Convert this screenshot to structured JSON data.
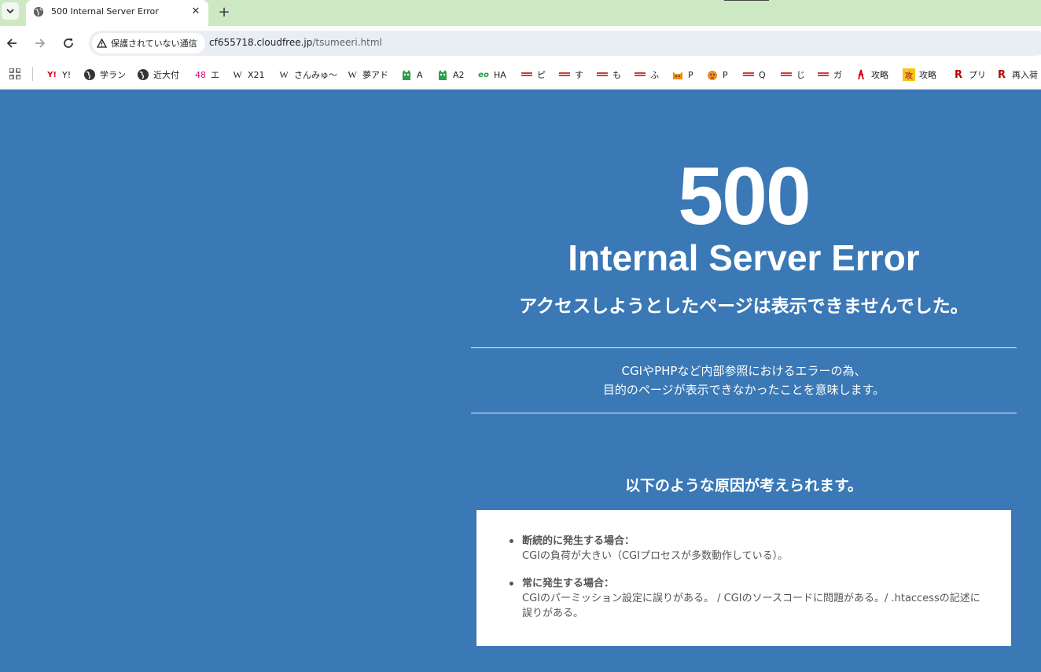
{
  "browser": {
    "tab": {
      "title": "500 Internal Server Error"
    },
    "address": {
      "security_label": "保護されていない通信",
      "domain": "cf655718.cloudfree.jp",
      "path": "/tsumeeri.html"
    },
    "bookmarks": [
      {
        "label": "Y!",
        "icon": "yahoo-icon"
      },
      {
        "label": "学ラン",
        "icon": "globe-icon"
      },
      {
        "label": "近大付",
        "icon": "globe-icon"
      },
      {
        "label": "エ",
        "icon_text": "48"
      },
      {
        "label": "X21",
        "icon_text": "W"
      },
      {
        "label": "さんみゅ〜",
        "icon_text": "W"
      },
      {
        "label": "夢アド",
        "icon_text": "W"
      },
      {
        "label": "A",
        "icon": "green-creature-icon"
      },
      {
        "label": "A2",
        "icon": "green-creature-icon"
      },
      {
        "label": "HA",
        "icon_text": "eo"
      },
      {
        "label": "ピ",
        "icon": "rakuten-icon"
      },
      {
        "label": "す",
        "icon": "rakuten-icon"
      },
      {
        "label": "も",
        "icon": "rakuten-icon"
      },
      {
        "label": "ふ",
        "icon": "rakuten-icon"
      },
      {
        "label": "P",
        "icon": "orange-cat-icon"
      },
      {
        "label": "P",
        "icon": "tiger-icon"
      },
      {
        "label": "Q",
        "icon": "rakuten-icon"
      },
      {
        "label": "じ",
        "icon": "rakuten-icon"
      },
      {
        "label": "ガ",
        "icon": "rakuten-icon"
      },
      {
        "label": "攻略",
        "icon": "red-figure-icon"
      },
      {
        "label": "攻略",
        "icon_text": "攻"
      },
      {
        "label": "プリ",
        "icon_text": "R"
      },
      {
        "label": "再入荷",
        "icon_text": "R"
      }
    ]
  },
  "page": {
    "code": "500",
    "title": "Internal Server Error",
    "subtitle": "アクセスしようとしたページは表示できませんでした。",
    "description_line1": "CGIやPHPなど内部参照におけるエラーの為、",
    "description_line2": "目的のページが表示できなかったことを意味します。",
    "causes_heading": "以下のような原因が考えられます。",
    "causes": [
      {
        "title": "断続的に発生する場合：",
        "text": "CGIの負荷が大きい（CGIプロセスが多数動作している）。"
      },
      {
        "title": "常に発生する場合：",
        "text": "CGIのパーミッション設定に誤りがある。 / CGIのソースコードに問題がある。/ .htaccessの記述に誤りがある。"
      }
    ]
  },
  "colors": {
    "page_bg": "#3a78b6",
    "tab_strip": "#cde9c3",
    "box_text": "#555555"
  }
}
